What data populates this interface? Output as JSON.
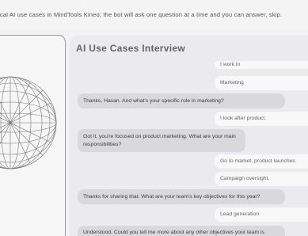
{
  "banner": {
    "text": "fy practical AI use cases in MindTools Kineo; the bot will ask one question at a time and you can answer, skip."
  },
  "chat": {
    "title": "AI Use Cases Interview",
    "messages": [
      {
        "role": "user",
        "text": "I work in"
      },
      {
        "role": "user",
        "text": "Marketing"
      },
      {
        "role": "bot",
        "text": "Thanks, Hasan. And what's your specific role in marketing?"
      },
      {
        "role": "user",
        "text": "I look after product."
      },
      {
        "role": "bot",
        "text": "Got it, you're focused on product marketing. What are your main responsibilities?"
      },
      {
        "role": "user",
        "text": "Go to market, product launches"
      },
      {
        "role": "user",
        "text": "Campaign oversight."
      },
      {
        "role": "bot",
        "text": "Thanks for sharing that. What are your team's key objectives for this year?"
      },
      {
        "role": "user",
        "text": "Lead generation"
      },
      {
        "role": "bot",
        "text": "Understood. Could you tell me more about any other objectives your team is"
      }
    ]
  },
  "icons": {
    "globe": "wireframe-globe-icon"
  }
}
